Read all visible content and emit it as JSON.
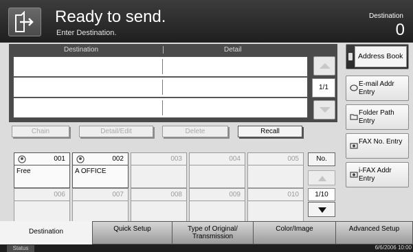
{
  "header": {
    "title": "Ready to send.",
    "subtitle": "Enter Destination.",
    "destination_label": "Destination",
    "destination_count": "0"
  },
  "table": {
    "col_destination": "Destination",
    "col_detail": "Detail",
    "page_indicator": "1/1"
  },
  "actions": {
    "chain": "Chain",
    "detail_edit": "Detail/Edit",
    "delete": "Delete",
    "recall": "Recall"
  },
  "right_buttons": {
    "address_book": "Address Book",
    "email": "E-mail Addr Entry",
    "folder": "Folder Path Entry",
    "fax": "FAX No. Entry",
    "ifax": "i-FAX Addr Entry"
  },
  "one_touch": [
    {
      "num": "001",
      "name": "Free"
    },
    {
      "num": "002",
      "name": "A OFFICE"
    },
    {
      "num": "003",
      "name": ""
    },
    {
      "num": "004",
      "name": ""
    },
    {
      "num": "005",
      "name": ""
    },
    {
      "num": "006",
      "name": ""
    },
    {
      "num": "007",
      "name": ""
    },
    {
      "num": "008",
      "name": ""
    },
    {
      "num": "009",
      "name": ""
    },
    {
      "num": "010",
      "name": ""
    }
  ],
  "one_touch_nav": {
    "no_label": "No.",
    "page_indicator": "1/10"
  },
  "tabs": {
    "destination": "Destination",
    "quick_setup": "Quick Setup",
    "type_of_original": "Type of Original/ Transmission",
    "color_image": "Color/Image",
    "advanced": "Advanced Setup"
  },
  "status": {
    "status_label": "Status",
    "datetime": "6/6/2006 10:00"
  }
}
